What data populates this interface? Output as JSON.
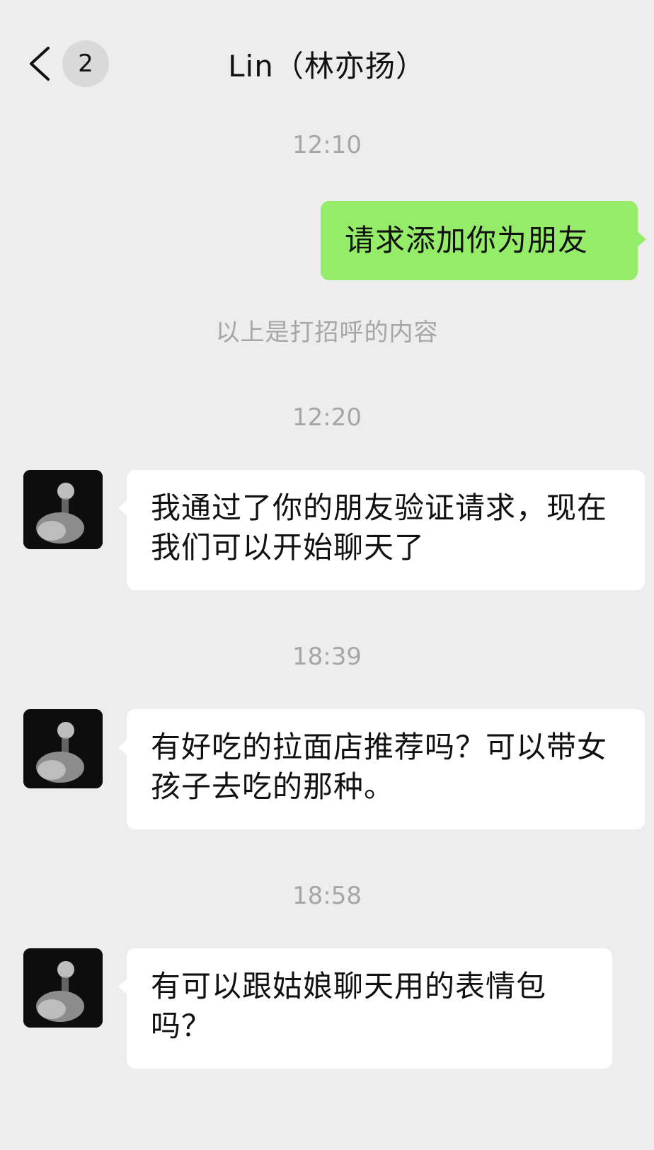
{
  "header": {
    "back_label": "back",
    "badge_count": "2",
    "title": "Lin（林亦扬）"
  },
  "messages": [
    {
      "type": "time",
      "text": "12:10"
    },
    {
      "type": "outgoing",
      "text": "请求添加你为朋友"
    },
    {
      "type": "system",
      "text": "以上是打招呼的内容"
    },
    {
      "type": "time",
      "text": "12:20"
    },
    {
      "type": "incoming",
      "text": "我通过了你的朋友验证请求，现在我们可以开始聊天了"
    },
    {
      "type": "time",
      "text": "18:39"
    },
    {
      "type": "incoming",
      "text": "有好吃的拉面店推荐吗？可以带女孩子去吃的那种。"
    },
    {
      "type": "time",
      "text": "18:58"
    },
    {
      "type": "incoming",
      "text": "有可以跟姑娘聊天用的表情包吗？"
    }
  ],
  "colors": {
    "background": "#ededed",
    "outgoing_bubble": "#95ec69",
    "incoming_bubble": "#ffffff",
    "timestamp": "#a6a6a6"
  },
  "icons": {
    "back": "chevron-left-icon",
    "avatar": "contact-avatar"
  }
}
